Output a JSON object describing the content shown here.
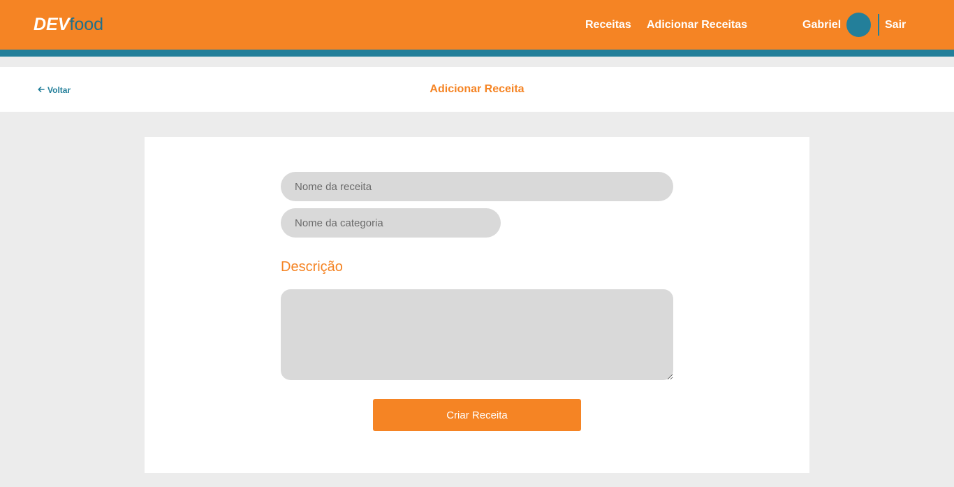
{
  "header": {
    "logo_dev": "DEV",
    "logo_food": "food",
    "nav": [
      {
        "label": "Receitas"
      },
      {
        "label": "Adicionar Receitas"
      }
    ],
    "user_name": "Gabriel",
    "logout_label": "Sair"
  },
  "subheader": {
    "back_label": "Voltar",
    "title": "Adicionar Receita"
  },
  "form": {
    "recipe_name_placeholder": "Nome da receita",
    "category_placeholder": "Nome da categoria",
    "description_label": "Descrição",
    "submit_label": "Criar Receita"
  },
  "colors": {
    "primary": "#f58424",
    "secondary": "#237f9a",
    "input_bg": "#d9d9d9",
    "page_bg": "#ececec"
  },
  "icons": {
    "back": "arrow-left-icon"
  }
}
